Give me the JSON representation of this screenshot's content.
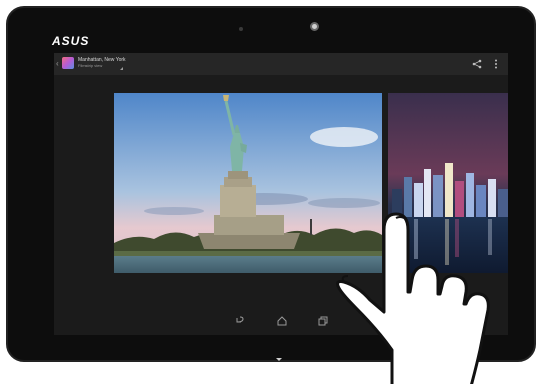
{
  "device": {
    "brand": "ASUS"
  },
  "action_bar": {
    "album_title": "Manhattan, New York",
    "album_subtitle": "Filmstrip view",
    "icons": [
      "share-icon",
      "overflow-menu-icon"
    ]
  },
  "photos": [
    {
      "name": "statue-of-liberty",
      "position": "current"
    },
    {
      "name": "night-skyline",
      "position": "next"
    }
  ],
  "navigation_bar": {
    "icons": [
      "back-icon",
      "home-icon",
      "recent-apps-icon"
    ]
  },
  "gesture": {
    "type": "swipe",
    "hand": "right-hand-pointer"
  },
  "colors": {
    "bezel": "#0d0d0d",
    "screen_bg": "#1b1b1b",
    "action_bar_bg": "#262626"
  }
}
